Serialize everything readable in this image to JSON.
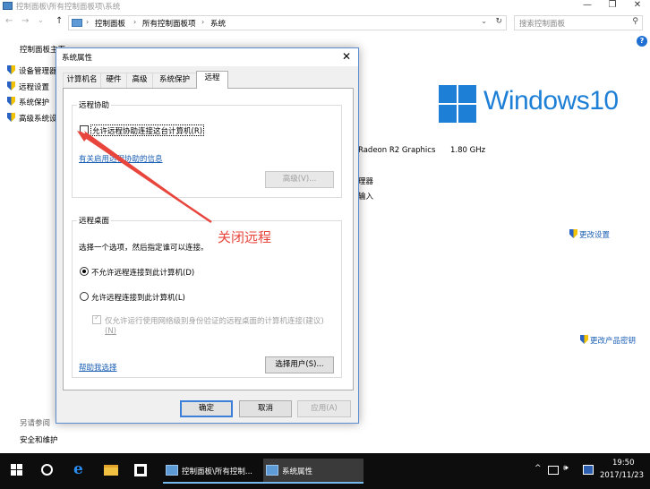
{
  "window": {
    "title": "控制面板\\所有控制面板项\\系统",
    "minimize": "—",
    "maximize": "❐",
    "close": "✕"
  },
  "nav": {
    "back": "←",
    "forward": "→",
    "dropdown": "⌄",
    "up": "↑"
  },
  "address": {
    "sep0": "›",
    "crumbs": [
      "控制面板",
      "所有控制面板项",
      "系统"
    ],
    "sep": "›",
    "dropdown": "⌄",
    "refresh": "↻"
  },
  "search": {
    "placeholder": "搜索控制面板",
    "icon": "⚲"
  },
  "help": "?",
  "sidebar": {
    "home": "控制面板主页",
    "items": [
      {
        "label": "设备管理器",
        "icon": "shield-icon"
      },
      {
        "label": "远程设置",
        "icon": "shield-icon"
      },
      {
        "label": "系统保护",
        "icon": "shield-icon"
      },
      {
        "label": "高级系统设置",
        "icon": "shield-icon"
      }
    ],
    "see_also": "另请参阅",
    "security": "安全和维护"
  },
  "system_info": {
    "logo_text": "Windows10",
    "cpu": "Radeon R2 Graphics",
    "cpu_speed": "1.80 GHz",
    "frag1": "理器",
    "frag2": "输入",
    "change_settings": "更改设置",
    "change_key": "更改产品密钥"
  },
  "dialog": {
    "title": "系统属性",
    "close": "✕",
    "tabs": [
      "计算机名",
      "硬件",
      "高级",
      "系统保护",
      "远程"
    ],
    "active_tab": 4,
    "assist": {
      "group_title": "远程协助",
      "checkbox_label": "允许远程协助连接这台计算机(R)",
      "checked": false,
      "info_link": "有关启用远程协助的信息",
      "advanced_button": "高级(V)..."
    },
    "desktop": {
      "group_title": "远程桌面",
      "instruction": "选择一个选项，然后指定谁可以连接。",
      "option1": "不允许远程连接到此计算机(D)",
      "option2": "允许远程连接到此计算机(L)",
      "selected": 1,
      "nla_line1": "仅允许运行使用网络级别身份验证的远程桌面的计算机连接(建议)",
      "nla_line2": "(N)",
      "help_link": "帮助我选择",
      "select_users_button": "选择用户(S)..."
    },
    "buttons": {
      "ok": "确定",
      "cancel": "取消",
      "apply": "应用(A)"
    }
  },
  "annotation": {
    "text": "关闭远程",
    "color": "#e8453c"
  },
  "taskbar": {
    "tasks": [
      {
        "label": "控制面板\\所有控制...",
        "active": false
      },
      {
        "label": "系统属性",
        "active": true
      }
    ],
    "tray": {
      "chevron": "^",
      "volume": "🕪",
      "ime": "中"
    },
    "time": "19:50",
    "date": "2017/11/23"
  },
  "colors": {
    "accent": "#1e7fd6",
    "link": "#1a5fb4",
    "taskbar": "#0d0d0d",
    "annotation": "#e8453c"
  }
}
